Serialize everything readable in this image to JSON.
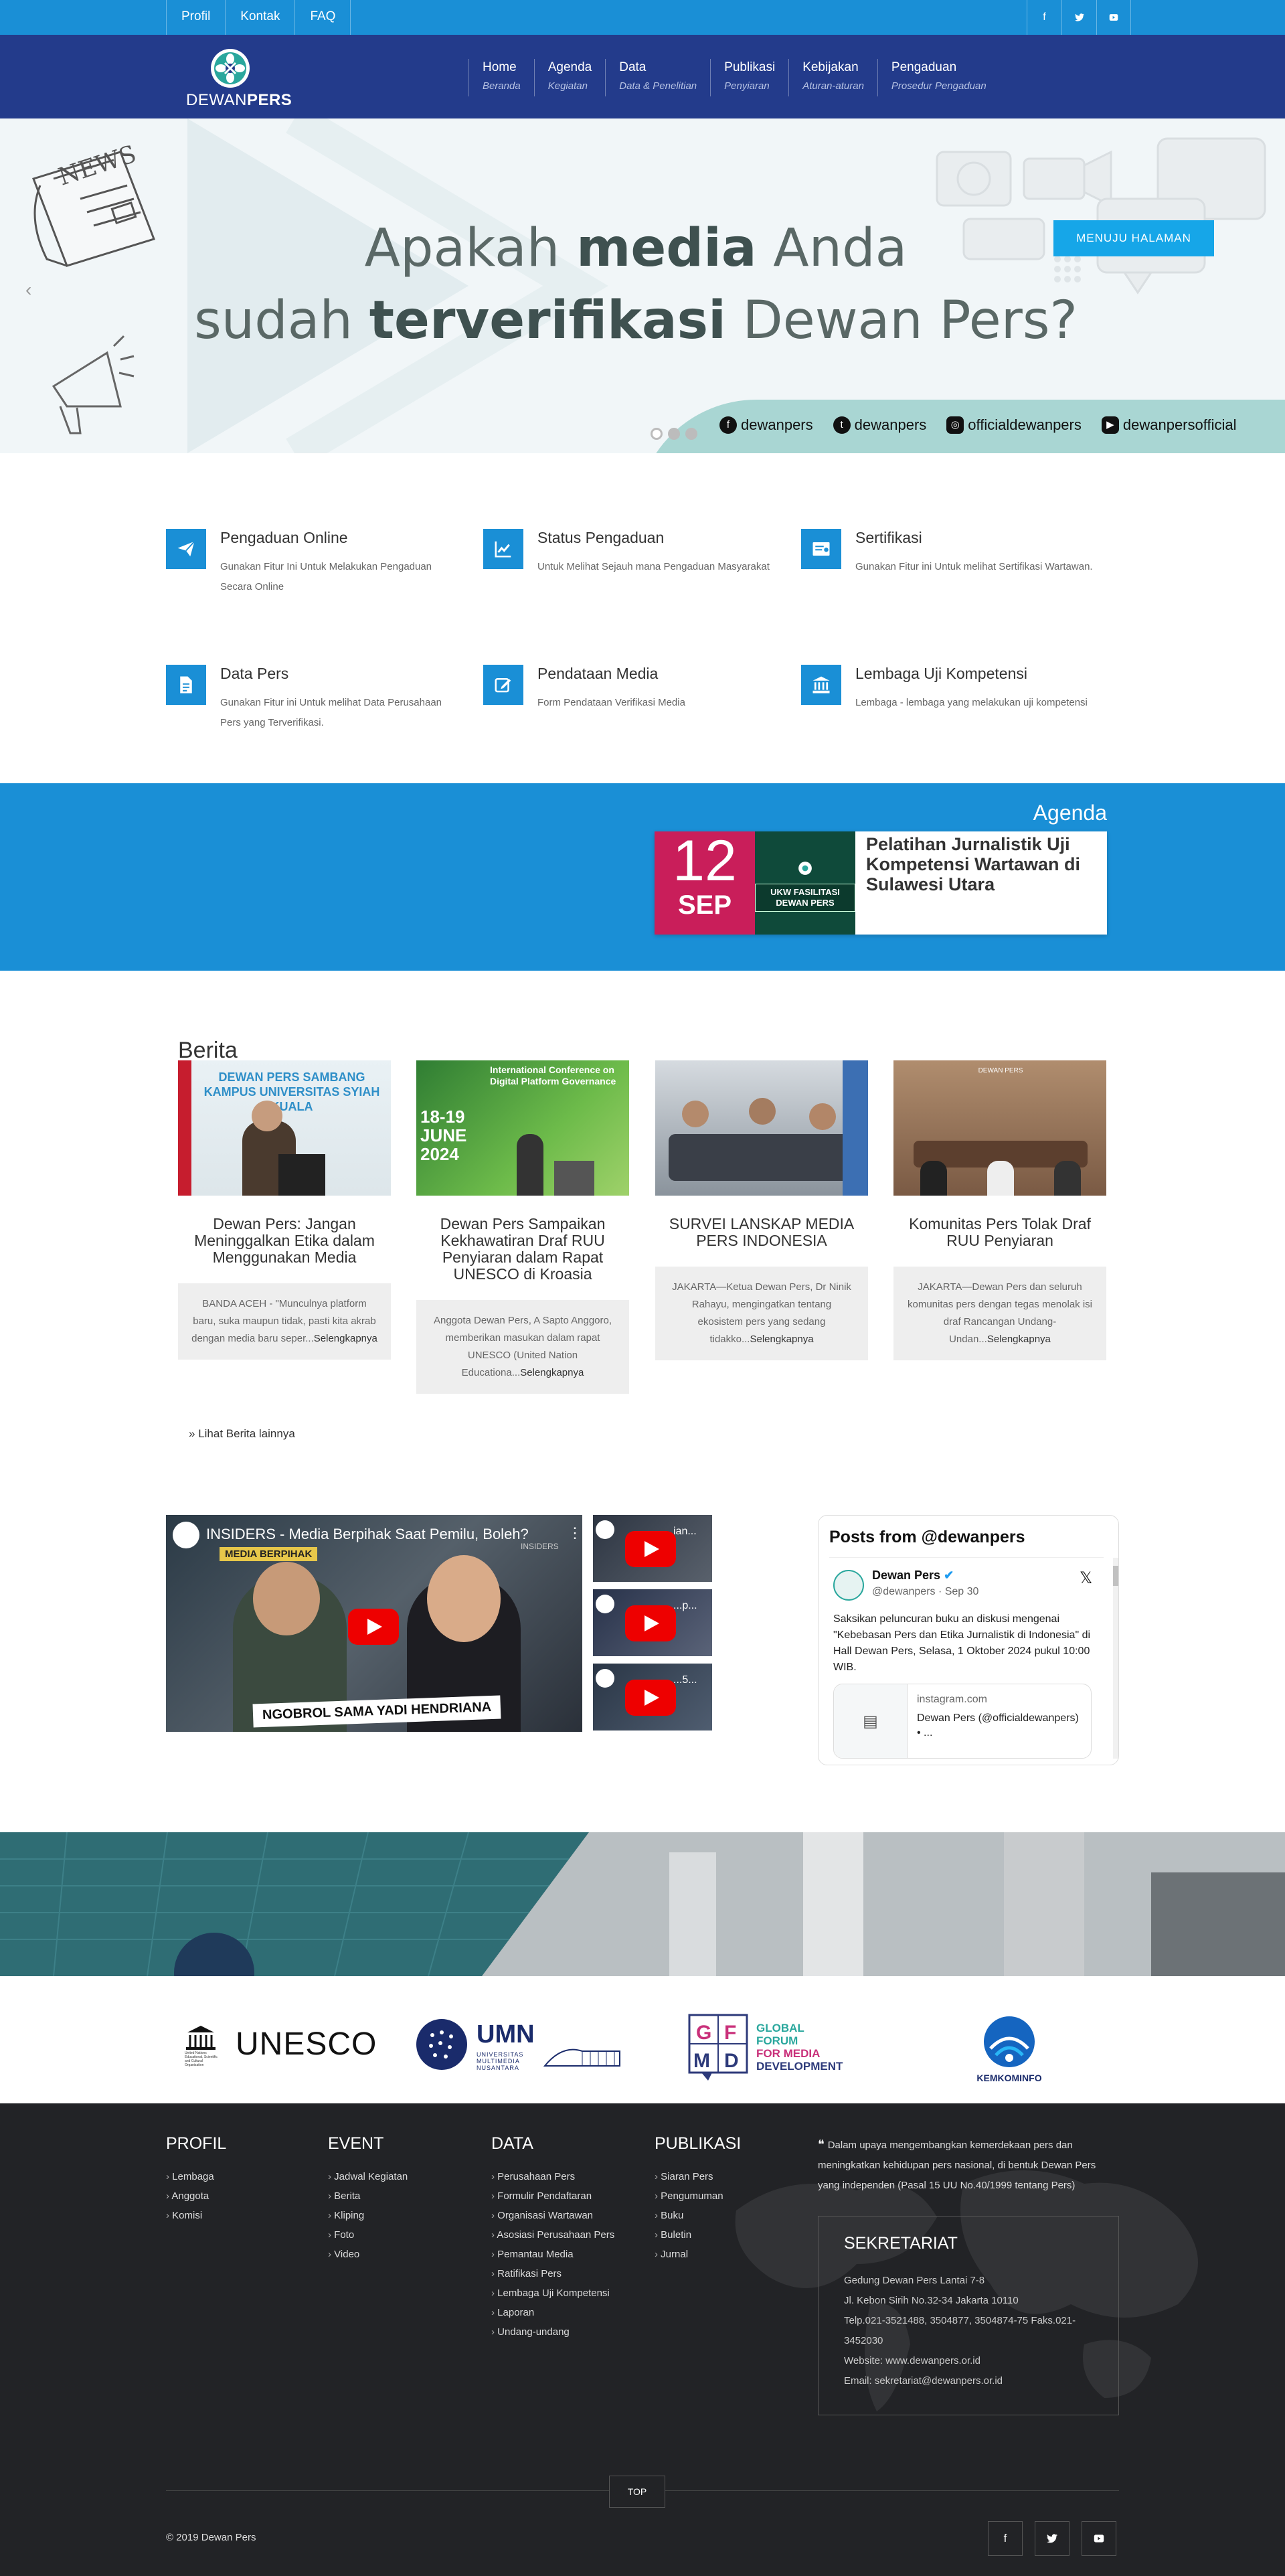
{
  "topbar": {
    "links": [
      "Profil",
      "Kontak",
      "FAQ"
    ],
    "social_icons": [
      "facebook-icon",
      "twitter-icon",
      "youtube-icon"
    ]
  },
  "header": {
    "logo_prefix": "DEWAN",
    "logo_suffix": "PERS",
    "nav": [
      {
        "title": "Home",
        "sub": "Beranda"
      },
      {
        "title": "Agenda",
        "sub": "Kegiatan"
      },
      {
        "title": "Data",
        "sub": "Data & Penelitian"
      },
      {
        "title": "Publikasi",
        "sub": "Penyiaran"
      },
      {
        "title": "Kebijakan",
        "sub": "Aturan-aturan"
      },
      {
        "title": "Pengaduan",
        "sub": "Prosedur Pengaduan"
      }
    ]
  },
  "hero": {
    "line1_a": "Apakah ",
    "line1_b": "media",
    "line1_c": " Anda",
    "line2_a": "sudah ",
    "line2_b": "terverifikasi",
    "line2_c": " Dewan Pers?",
    "cta": "MENUJU HALAMAN",
    "newspaper_text": "NEWS",
    "social": [
      "dewanpers",
      "dewanpers",
      "officialdewanpers",
      "dewanpersofficial"
    ],
    "slides": 3,
    "active_slide": 1
  },
  "features": [
    {
      "icon": "paper-plane-icon",
      "title": "Pengaduan Online",
      "desc": "Gunakan Fitur Ini Untuk Melakukan Pengaduan Secara Online"
    },
    {
      "icon": "chart-line-icon",
      "title": "Status Pengaduan",
      "desc": "Untuk Melihat Sejauh mana Pengaduan Masyarakat"
    },
    {
      "icon": "certificate-icon",
      "title": "Sertifikasi",
      "desc": "Gunakan Fitur ini Untuk melihat Sertifikasi Wartawan."
    },
    {
      "icon": "document-icon",
      "title": "Data Pers",
      "desc": "Gunakan Fitur ini Untuk melihat Data Perusahaan Pers yang Terverifikasi."
    },
    {
      "icon": "edit-icon",
      "title": "Pendataan Media",
      "desc": "Form Pendataan Verifikasi Media"
    },
    {
      "icon": "institution-icon",
      "title": "Lembaga Uji Kompetensi",
      "desc": "Lembaga - lembaga yang melakukan uji kompetensi"
    }
  ],
  "agenda": {
    "heading": "Agenda",
    "day": "12",
    "month": "SEP",
    "thumb_text": "UKW FASILITASI DEWAN PERS",
    "title": "Pelatihan Jurnalistik Uji Kompetensi Wartawan di Sulawesi Utara"
  },
  "berita": {
    "heading": "Berita",
    "more": "Lihat Berita lainnya",
    "read_more": "Selengkapnya",
    "items": [
      {
        "title": "Dewan Pers: Jangan Meninggalkan Etika dalam Menggunakan Media",
        "excerpt": "BANDA ACEH - \"Munculnya platform baru, suka maupun tidak, pasti kita akrab dengan media baru seper...",
        "banner": "DEWAN PERS SAMBANG KAMPUS UNIVERSITAS SYIAH KUALA"
      },
      {
        "title": "Dewan Pers Sampaikan Kekhawatiran Draf RUU Penyiaran dalam Rapat UNESCO di Kroasia",
        "excerpt": "Anggota Dewan Pers, A Sapto Anggoro, memberikan masukan dalam rapat UNESCO (United Nation Educationa...",
        "banner": "International Conference on Digital Platform Governance",
        "date_text": "18-19 JUNE 2024"
      },
      {
        "title": "SURVEI LANSKAP MEDIA PERS INDONESIA",
        "excerpt": "JAKARTA—Ketua Dewan Pers, Dr Ninik Rahayu, mengingatkan tentang ekosistem pers yang sedang tidakko...",
        "banner": ""
      },
      {
        "title": "Komunitas Pers Tolak Draf RUU Penyiaran",
        "excerpt": "JAKARTA—Dewan Pers dan seluruh komunitas pers dengan tegas menolak isi draf Rancangan Undang-Undan...",
        "banner": "DEWAN PERS"
      }
    ]
  },
  "video": {
    "title": "INSIDERS - Media Berpihak Saat Pemilu, Boleh?",
    "channel": "INSIDERS",
    "caption": "NGOBROL SAMA YADI HENDRIANA",
    "overlay": "MEDIA BERPIHAK",
    "thumbs": [
      "ian...",
      "...p...",
      "...5..."
    ]
  },
  "tweet": {
    "header": "Posts from @dewanpers",
    "name": "Dewan Pers",
    "handle": "@dewanpers · Sep 30",
    "text": "Saksikan peluncuran buku an diskusi mengenai \"Kebebasan Pers dan Etika Jurnalistik di Indonesia\" di Hall Dewan Pers, Selasa, 1 Oktober 2024 pukul 10:00 WIB.",
    "link_domain": "instagram.com",
    "link_title": "Dewan Pers (@officialdewanpers) • ..."
  },
  "partners": {
    "unesco": "UNESCO",
    "unesco_sub": "United Nations Educational, Scientific and Cultural Organization",
    "umn": "UMN",
    "umn_sub": "UNIVERSITAS MULTIMEDIA NUSANTARA",
    "gfmd_letters": "GFMD",
    "gfmd_l1": "GLOBAL",
    "gfmd_l2": "FORUM",
    "gfmd_l3": "FOR MEDIA",
    "gfmd_l4": "DEVELOPMENT",
    "kominfo": "KEMKOMINFO"
  },
  "footer": {
    "cols": [
      {
        "title": "PROFIL",
        "items": [
          "Lembaga",
          "Anggota",
          "Komisi"
        ]
      },
      {
        "title": "EVENT",
        "items": [
          "Jadwal Kegiatan",
          "Berita",
          "Kliping",
          "Foto",
          "Video"
        ]
      },
      {
        "title": "DATA",
        "items": [
          "Perusahaan Pers",
          "Formulir Pendaftaran",
          "Organisasi Wartawan",
          "Asosiasi Perusahaan Pers",
          "Pemantau Media",
          "Ratifikasi Pers",
          "Lembaga Uji Kompetensi",
          "Laporan",
          "Undang-undang"
        ]
      },
      {
        "title": "PUBLIKASI",
        "items": [
          "Siaran Pers",
          "Pengumuman",
          "Buku",
          "Buletin",
          "Jurnal"
        ]
      }
    ],
    "quote": "Dalam upaya mengembangkan kemerdekaan pers dan meningkatkan kehidupan pers nasional, di bentuk Dewan Pers yang independen (Pasal 15 UU No.40/1999 tentang Pers)",
    "sekretariat": {
      "title": "SEKRETARIAT",
      "lines": [
        "Gedung Dewan Pers Lantai 7-8",
        "Jl. Kebon Sirih No.32-34 Jakarta 10110",
        "Telp.021-3521488, 3504877, 3504874-75 Faks.021-3452030",
        "Website: www.dewanpers.or.id",
        "Email: sekretariat@dewanpers.or.id"
      ]
    },
    "top": "TOP",
    "copyright": "© 2019 Dewan Pers"
  },
  "colors": {
    "topbar": "#1a8fd6",
    "header": "#233b8b",
    "agenda_date": "#c91e5a",
    "footer": "#222326",
    "cta": "#16a6e8"
  }
}
